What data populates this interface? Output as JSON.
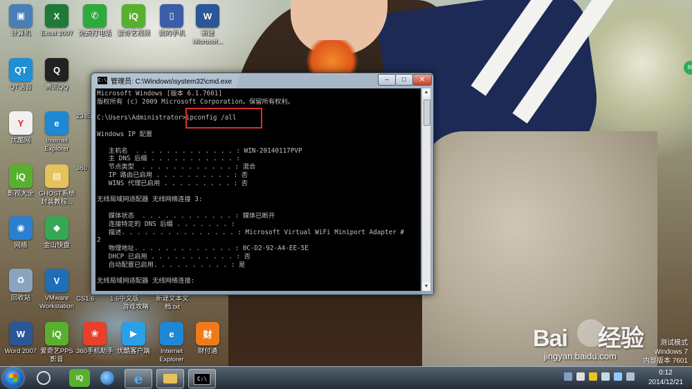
{
  "desktop_icons": [
    {
      "label": "计算机",
      "icon": "computer-icon",
      "color": "#4a7fb5",
      "glyph": "▣"
    },
    {
      "label": "Excel 2007",
      "icon": "excel-icon",
      "color": "#1f7a3a",
      "glyph": "X"
    },
    {
      "label": "免费打电话",
      "icon": "phone-icon",
      "color": "#2eaa3c",
      "glyph": "✆"
    },
    {
      "label": "爱奇艺视频",
      "icon": "iqiyi-icon",
      "color": "#59b02e",
      "glyph": "iQ"
    },
    {
      "label": "我的手机",
      "icon": "mobile-icon",
      "color": "#3b5ea8",
      "glyph": "▯"
    },
    {
      "label": "新建",
      "label2": "Microsof...",
      "icon": "word-doc-icon",
      "color": "#2b5797",
      "glyph": "W"
    },
    {
      "label": "QT语音",
      "icon": "qt-voice-icon",
      "color": "#1f8fd6",
      "glyph": "QT"
    },
    {
      "label": "腾讯QQ",
      "icon": "qq-icon",
      "color": "#222222",
      "glyph": "Q"
    },
    {
      "label": "优酷网",
      "icon": "youku-icon",
      "color": "#f0f0f0",
      "glyph": "Y"
    },
    {
      "label": "Internet",
      "label2": "Explorer",
      "icon": "ie-icon",
      "color": "#1e88d6",
      "glyph": "e"
    },
    {
      "label": "影视大全",
      "icon": "video-icon",
      "color": "#59b02e",
      "glyph": "iQ"
    },
    {
      "label": "GHOST系统",
      "label2": "封装教程...",
      "icon": "folder-icon",
      "color": "#e5c25a",
      "glyph": "▤"
    },
    {
      "label": "网络",
      "icon": "network-icon",
      "color": "#2a7fcf",
      "glyph": "◉"
    },
    {
      "label": "金山快盘",
      "icon": "kuaipan-icon",
      "color": "#35a853",
      "glyph": "◆"
    },
    {
      "label": "回收站",
      "icon": "recycle-bin-icon",
      "color": "#8aa4c0",
      "glyph": "♻"
    },
    {
      "label": "VMware",
      "label2": "Workstation",
      "icon": "vmware-icon",
      "color": "#1d6fb8",
      "glyph": "V"
    },
    {
      "label": "Word 2007",
      "icon": "word-icon",
      "color": "#2b5797",
      "glyph": "W"
    },
    {
      "label": "爱奇艺PPS",
      "label2": "影音",
      "icon": "pps-icon",
      "color": "#59b02e",
      "glyph": "iQ"
    },
    {
      "label": "360手机助手",
      "icon": "360-assistant-icon",
      "color": "#e8402a",
      "glyph": "❀"
    },
    {
      "label": "优酷客户端",
      "icon": "youku-client-icon",
      "color": "#2aa0e8",
      "glyph": "▶"
    },
    {
      "label": "Internet",
      "label2": "Explorer",
      "icon": "ie-icon",
      "color": "#1e88d6",
      "glyph": "e"
    },
    {
      "label": "财付通",
      "icon": "tenpay-icon",
      "color": "#f07a1a",
      "glyph": "财"
    }
  ],
  "cmd": {
    "title": "管理员: C:\\Windows\\system32\\cmd.exe",
    "title_icon_text": "C:\\",
    "min": "–",
    "max": "□",
    "close": "✕",
    "lines": [
      "Microsoft Windows [版本 6.1.7601]",
      "版权所有 (c) 2009 Microsoft Corporation。保留所有权利。",
      "",
      "C:\\Users\\Administrator>ipconfig /all",
      "",
      "Windows IP 配置",
      "",
      "   主机名  . . . . . . . . . . . . . : WIN-20140117PVP",
      "   主 DNS 后缀 . . . . . . . . . . . :",
      "   节点类型  . . . . . . . . . . . . : 混合",
      "   IP 路由已启用 . . . . . . . . . . : 否",
      "   WINS 代理已启用 . . . . . . . . . : 否",
      "",
      "无线局域网适配器 无线网络连接 3:",
      "",
      "   媒体状态  . . . . . . . . . . . . : 媒体已断开",
      "   连接特定的 DNS 后缀 . . . . . . . :",
      "   描述. . . . . . . . . . . . . . . : Microsoft Virtual WiFi Miniport Adapter #",
      "2",
      "   物理地址. . . . . . . . . . . . . : 0C-D2-92-A4-EE-5E",
      "   DHCP 已启用 . . . . . . . . . . . : 否",
      "   自动配置已启用. . . . . . . . . . : 是",
      "",
      "无线局域网适配器 无线网络连接:"
    ]
  },
  "partial_icons": {
    "i2345": "2345",
    "i360": "360",
    "label_cs": "CS1.6",
    "label_a": "1.6中文版",
    "label_b": "游戏攻略",
    "label_c": "新建文本文",
    "label_d": "档.txt"
  },
  "taskbar": {
    "items": [
      "iqiyi",
      "globe",
      "ie",
      "explorer",
      "cmd"
    ],
    "cmd_label": "C:\\",
    "clock_time": "0:12",
    "clock_date": "2014/12/21"
  },
  "watermark": {
    "brand": "Bai",
    "brand2": "经验",
    "url": "jingyan.baidu.com"
  },
  "test_mode": {
    "line1": "测试模式",
    "line2": "Windows 7",
    "line3": "内部版本 7601"
  },
  "side_badge": "69"
}
